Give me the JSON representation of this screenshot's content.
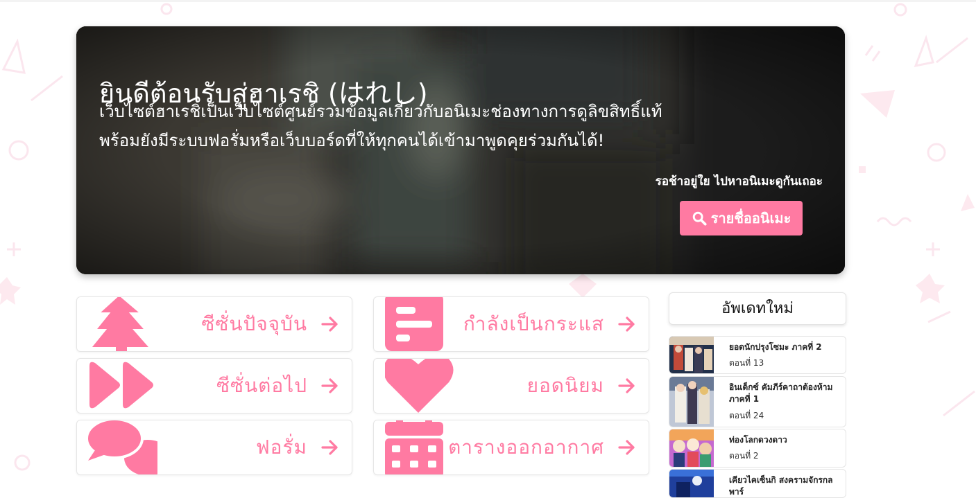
{
  "hero": {
    "title": "ยินดีต้อนรับสู่ฮาเรชิ (はれし)",
    "line1": "เว็บไซต์ฮาเรชิเป็นเว็บไซต์ศูนย์รวมข้อมูลเกี่ยวกับอนิเมะช่องทางการดูลิขสิทธิ์แท้",
    "line2": "พร้อมยังมีระบบฟอรั่มหรือเว็บบอร์ดที่ให้ทุกคนได้เข้ามาพูดคุยร่วมกันได้!",
    "tagline": "รอช้าอยู่ใย ไปหาอนิเมะดูกันเถอะ",
    "button_label": "รายชื่ออนิเมะ",
    "button_icon": "search-icon"
  },
  "menu": [
    {
      "label": "ซีซั่นปัจจุบัน",
      "icon": "tree-icon"
    },
    {
      "label": "กำลังเป็นกระแส",
      "icon": "bar-chart-icon"
    },
    {
      "label": "ซีซั่นต่อไป",
      "icon": "fast-forward-icon"
    },
    {
      "label": "ยอดนิยม",
      "icon": "heart-icon"
    },
    {
      "label": "ฟอรั่ม",
      "icon": "comments-icon"
    },
    {
      "label": "ตารางออกอากาศ",
      "icon": "calendar-icon"
    }
  ],
  "sidebar": {
    "title": "อัพเดทใหม่",
    "updates": [
      {
        "title": "ยอดนักปรุงโซมะ ภาคที่ 2",
        "episode": "ตอนที่ 13"
      },
      {
        "title": "อินเด็กซ์ คัมภีร์คาถาต้องห้าม ภาคที่ 1",
        "episode": "ตอนที่ 24"
      },
      {
        "title": "ท่องโลกดวงดาว",
        "episode": "ตอนที่ 2"
      },
      {
        "title": "เคียวไคเซ็นกิ สงครามจักรกล พาร์",
        "episode": ""
      }
    ]
  },
  "colors": {
    "accent": "#ff7aa2",
    "hero_bg": "#2a2a28"
  }
}
